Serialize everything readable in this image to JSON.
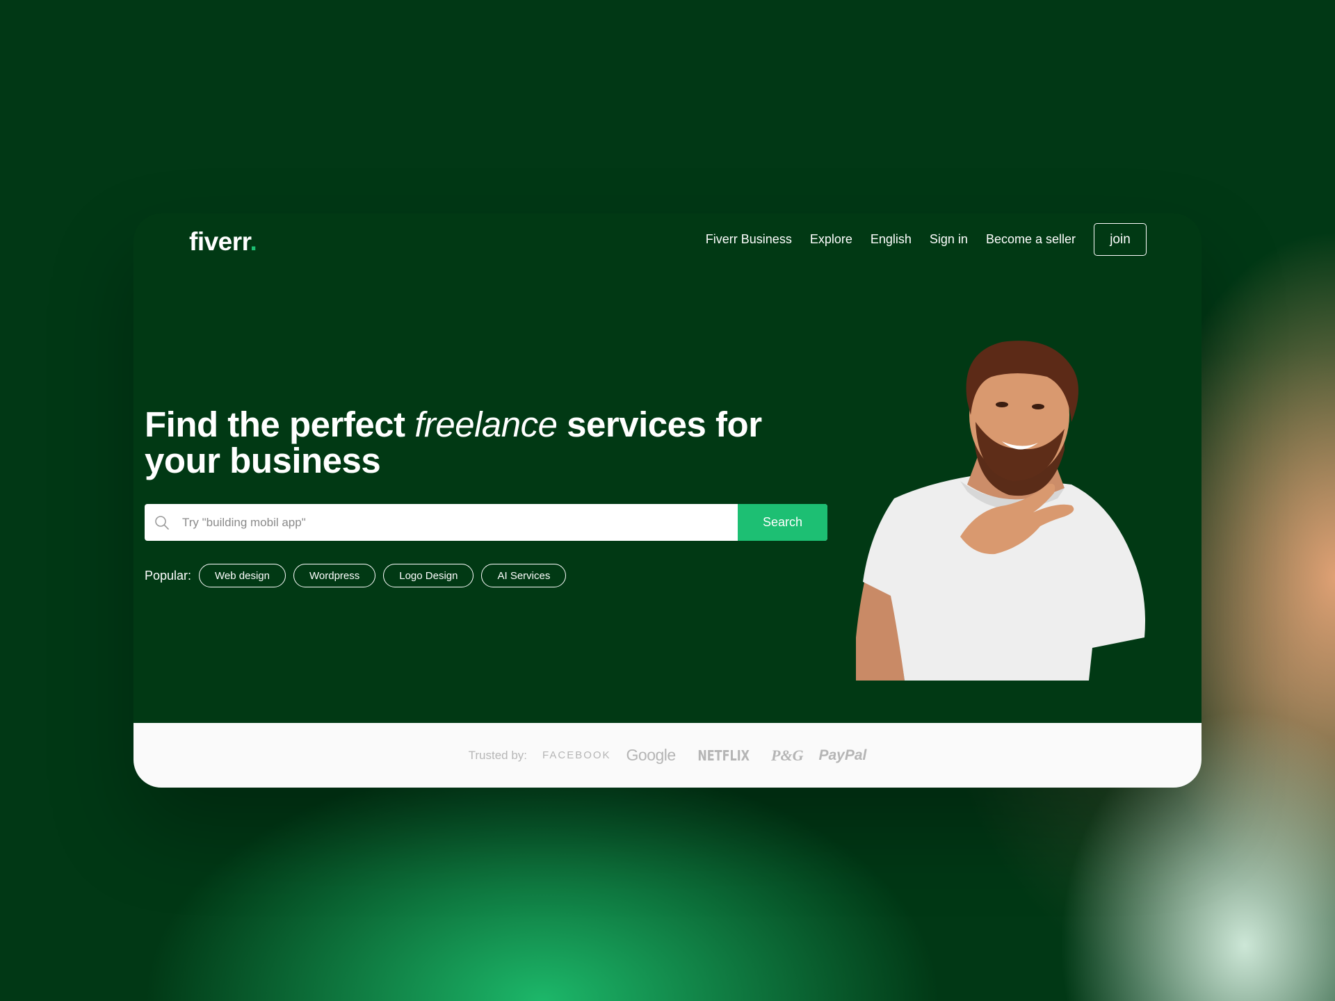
{
  "brand": {
    "logo_text": "fiverr",
    "logo_dot": ".",
    "accent_color": "#1dbf73",
    "hero_bg_color": "#013914"
  },
  "nav": {
    "items": [
      {
        "label": "Fiverr Business"
      },
      {
        "label": "Explore"
      },
      {
        "label": "English"
      },
      {
        "label": "Sign in"
      },
      {
        "label": "Become a seller"
      }
    ],
    "join_label": "join"
  },
  "hero": {
    "headline_part1": "Find the perfect ",
    "headline_italic": "freelance",
    "headline_part2": " services for your business",
    "image": "smiling-bearded-man-white-tshirt"
  },
  "search": {
    "placeholder": "Try \"building mobil app\"",
    "value": "",
    "button_label": "Search",
    "icon": "search-icon"
  },
  "popular": {
    "label": "Popular:",
    "tags": [
      {
        "label": "Web design"
      },
      {
        "label": "Wordpress"
      },
      {
        "label": "Logo Design"
      },
      {
        "label": "AI Services"
      }
    ]
  },
  "trusted": {
    "label": "Trusted by:",
    "brands": [
      {
        "name": "FACEBOOK"
      },
      {
        "name": "Google"
      },
      {
        "name": "NETFLIX"
      },
      {
        "name": "P&G"
      },
      {
        "name": "PayPal"
      }
    ]
  }
}
